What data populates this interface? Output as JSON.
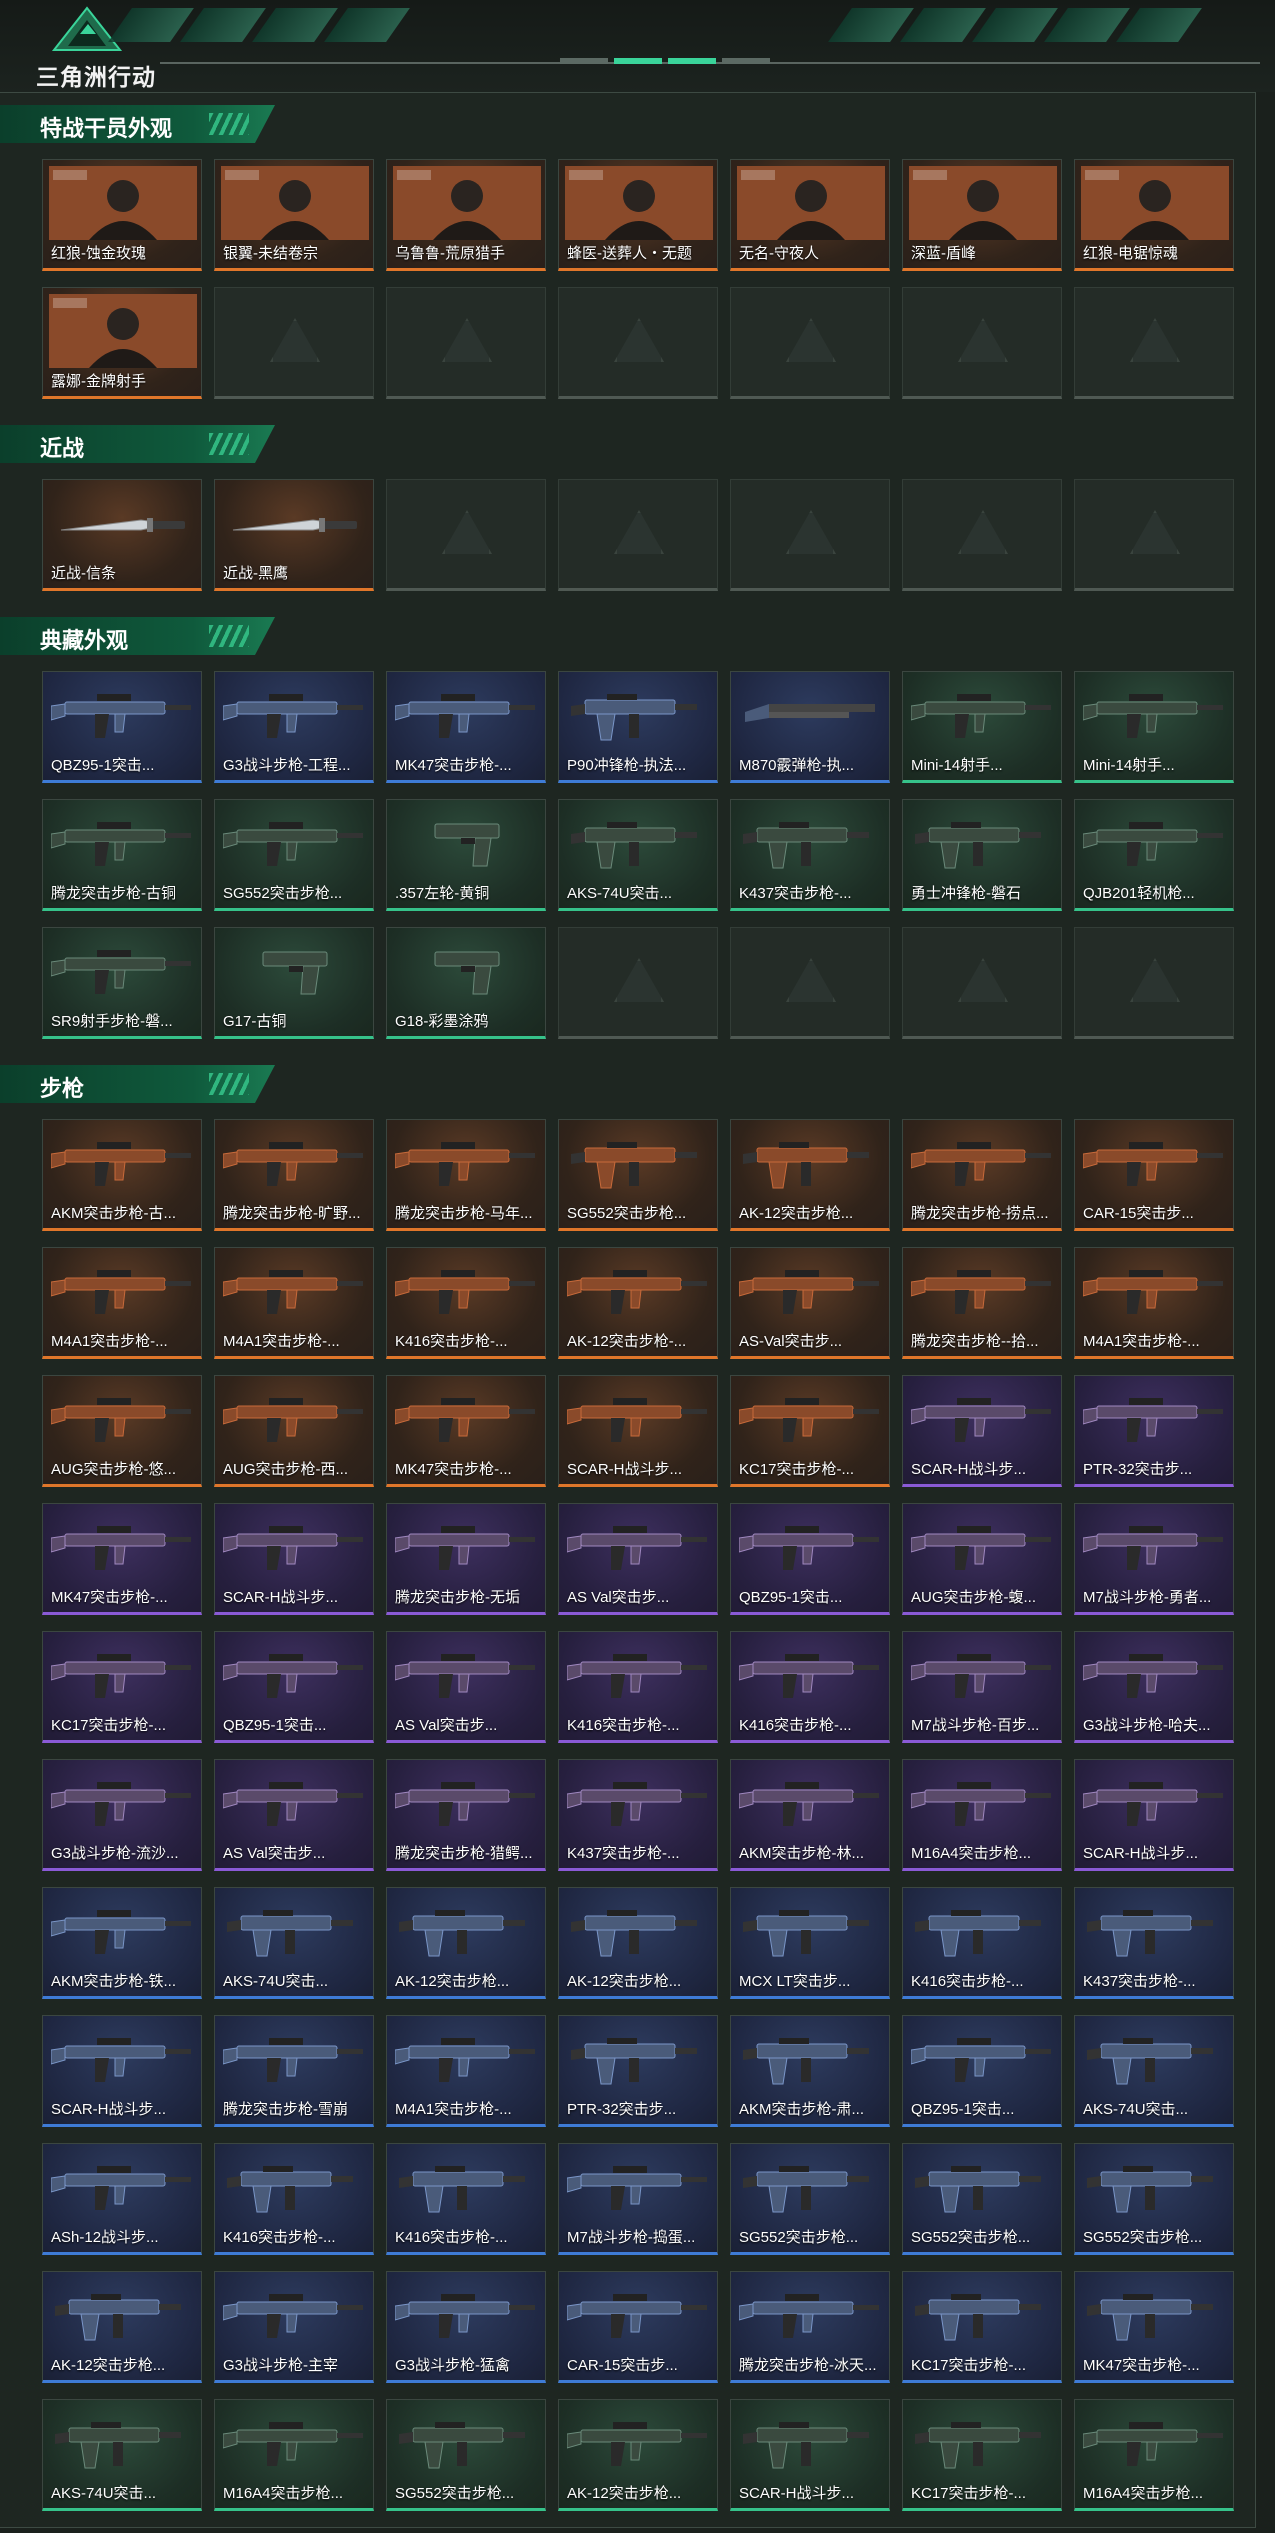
{
  "app": {
    "logo_text": "三角洲行动"
  },
  "sections": [
    {
      "title": "特战干员外观",
      "rows": 2,
      "items": [
        {
          "label": "红狼-蚀金玫瑰",
          "rarity": "orange",
          "kind": "operator"
        },
        {
          "label": "银翼-未结卷宗",
          "rarity": "orange",
          "kind": "operator"
        },
        {
          "label": "乌鲁鲁-荒原猎手",
          "rarity": "orange",
          "kind": "operator"
        },
        {
          "label": "蜂医-送葬人・无题",
          "rarity": "orange",
          "kind": "operator"
        },
        {
          "label": "无名-守夜人",
          "rarity": "orange",
          "kind": "operator"
        },
        {
          "label": "深蓝-盾峰",
          "rarity": "orange",
          "kind": "operator"
        },
        {
          "label": "红狼-电锯惊魂",
          "rarity": "orange",
          "kind": "operator"
        },
        {
          "label": "露娜-金牌射手",
          "rarity": "orange",
          "kind": "operator"
        }
      ]
    },
    {
      "title": "近战",
      "rows": 1,
      "items": [
        {
          "label": "近战-信条",
          "rarity": "orange",
          "kind": "knife"
        },
        {
          "label": "近战-黑鹰",
          "rarity": "orange",
          "kind": "knife"
        }
      ]
    },
    {
      "title": "典藏外观",
      "rows": 3,
      "items": [
        {
          "label": "QBZ95-1突击...",
          "rarity": "blue",
          "kind": "rifle"
        },
        {
          "label": "G3战斗步枪-工程...",
          "rarity": "blue",
          "kind": "rifle"
        },
        {
          "label": "MK47突击步枪-...",
          "rarity": "blue",
          "kind": "rifle"
        },
        {
          "label": "P90冲锋枪-执法...",
          "rarity": "blue",
          "kind": "smg"
        },
        {
          "label": "M870霰弹枪-执...",
          "rarity": "blue",
          "kind": "shotgun"
        },
        {
          "label": "Mini-14射手...",
          "rarity": "green",
          "kind": "rifle"
        },
        {
          "label": "Mini-14射手...",
          "rarity": "green",
          "kind": "rifle"
        },
        {
          "label": "腾龙突击步枪-古铜",
          "rarity": "green",
          "kind": "rifle"
        },
        {
          "label": "SG552突击步枪...",
          "rarity": "green",
          "kind": "rifle"
        },
        {
          "label": ".357左轮-黄铜",
          "rarity": "green",
          "kind": "pistol"
        },
        {
          "label": "AKS-74U突击...",
          "rarity": "green",
          "kind": "smg"
        },
        {
          "label": "K437突击步枪-...",
          "rarity": "green",
          "kind": "smg"
        },
        {
          "label": "勇士冲锋枪-磐石",
          "rarity": "green",
          "kind": "smg"
        },
        {
          "label": "QJB201轻机枪...",
          "rarity": "green",
          "kind": "rifle"
        },
        {
          "label": "SR9射手步枪-磐...",
          "rarity": "green",
          "kind": "rifle"
        },
        {
          "label": "G17-古铜",
          "rarity": "green",
          "kind": "pistol"
        },
        {
          "label": "G18-彩墨涂鸦",
          "rarity": "green",
          "kind": "pistol"
        }
      ]
    },
    {
      "title": "步枪",
      "rows": 11,
      "items": [
        {
          "label": "AKM突击步枪-古...",
          "rarity": "orange",
          "kind": "rifle"
        },
        {
          "label": "腾龙突击步枪-旷野...",
          "rarity": "orange",
          "kind": "rifle"
        },
        {
          "label": "腾龙突击步枪-马年...",
          "rarity": "orange",
          "kind": "rifle"
        },
        {
          "label": "SG552突击步枪...",
          "rarity": "orange",
          "kind": "smg"
        },
        {
          "label": "AK-12突击步枪...",
          "rarity": "orange",
          "kind": "smg"
        },
        {
          "label": "腾龙突击步枪-捞点...",
          "rarity": "orange",
          "kind": "rifle"
        },
        {
          "label": "CAR-15突击步...",
          "rarity": "orange",
          "kind": "rifle"
        },
        {
          "label": "M4A1突击步枪-...",
          "rarity": "orange",
          "kind": "rifle"
        },
        {
          "label": "M4A1突击步枪-...",
          "rarity": "orange",
          "kind": "rifle"
        },
        {
          "label": "K416突击步枪-...",
          "rarity": "orange",
          "kind": "rifle"
        },
        {
          "label": "AK-12突击步枪-...",
          "rarity": "orange",
          "kind": "rifle"
        },
        {
          "label": "AS-Val突击步...",
          "rarity": "orange",
          "kind": "rifle"
        },
        {
          "label": "腾龙突击步枪--拾...",
          "rarity": "orange",
          "kind": "rifle"
        },
        {
          "label": "M4A1突击步枪-...",
          "rarity": "orange",
          "kind": "rifle"
        },
        {
          "label": "AUG突击步枪-悠...",
          "rarity": "orange",
          "kind": "rifle"
        },
        {
          "label": "AUG突击步枪-西...",
          "rarity": "orange",
          "kind": "rifle"
        },
        {
          "label": "MK47突击步枪-...",
          "rarity": "orange",
          "kind": "rifle"
        },
        {
          "label": "SCAR-H战斗步...",
          "rarity": "orange",
          "kind": "rifle"
        },
        {
          "label": "KC17突击步枪-...",
          "rarity": "orange",
          "kind": "rifle"
        },
        {
          "label": "SCAR-H战斗步...",
          "rarity": "purple",
          "kind": "rifle"
        },
        {
          "label": "PTR-32突击步...",
          "rarity": "purple",
          "kind": "rifle"
        },
        {
          "label": "MK47突击步枪-...",
          "rarity": "purple",
          "kind": "rifle"
        },
        {
          "label": "SCAR-H战斗步...",
          "rarity": "purple",
          "kind": "rifle"
        },
        {
          "label": "腾龙突击步枪-无垢",
          "rarity": "purple",
          "kind": "rifle"
        },
        {
          "label": "AS Val突击步...",
          "rarity": "purple",
          "kind": "rifle"
        },
        {
          "label": "QBZ95-1突击...",
          "rarity": "purple",
          "kind": "rifle"
        },
        {
          "label": "AUG突击步枪-蝮...",
          "rarity": "purple",
          "kind": "rifle"
        },
        {
          "label": "M7战斗步枪-勇者...",
          "rarity": "purple",
          "kind": "rifle"
        },
        {
          "label": "KC17突击步枪-...",
          "rarity": "purple",
          "kind": "rifle"
        },
        {
          "label": "QBZ95-1突击...",
          "rarity": "purple",
          "kind": "rifle"
        },
        {
          "label": "AS Val突击步...",
          "rarity": "purple",
          "kind": "rifle"
        },
        {
          "label": "K416突击步枪-...",
          "rarity": "purple",
          "kind": "rifle"
        },
        {
          "label": "K416突击步枪-...",
          "rarity": "purple",
          "kind": "rifle"
        },
        {
          "label": "M7战斗步枪-百步...",
          "rarity": "purple",
          "kind": "rifle"
        },
        {
          "label": "G3战斗步枪-哈夫...",
          "rarity": "purple",
          "kind": "rifle"
        },
        {
          "label": "G3战斗步枪-流沙...",
          "rarity": "purple",
          "kind": "rifle"
        },
        {
          "label": "AS Val突击步...",
          "rarity": "purple",
          "kind": "rifle"
        },
        {
          "label": "腾龙突击步枪-猎鳄...",
          "rarity": "purple",
          "kind": "rifle"
        },
        {
          "label": "K437突击步枪-...",
          "rarity": "purple",
          "kind": "rifle"
        },
        {
          "label": "AKM突击步枪-林...",
          "rarity": "purple",
          "kind": "rifle"
        },
        {
          "label": "M16A4突击步枪...",
          "rarity": "purple",
          "kind": "rifle"
        },
        {
          "label": "SCAR-H战斗步...",
          "rarity": "purple",
          "kind": "rifle"
        },
        {
          "label": "AKM突击步枪-铁...",
          "rarity": "blue",
          "kind": "rifle"
        },
        {
          "label": "AKS-74U突击...",
          "rarity": "blue",
          "kind": "smg"
        },
        {
          "label": "AK-12突击步枪...",
          "rarity": "blue",
          "kind": "smg"
        },
        {
          "label": "AK-12突击步枪...",
          "rarity": "blue",
          "kind": "smg"
        },
        {
          "label": "MCX LT突击步...",
          "rarity": "blue",
          "kind": "smg"
        },
        {
          "label": "K416突击步枪-...",
          "rarity": "blue",
          "kind": "smg"
        },
        {
          "label": "K437突击步枪-...",
          "rarity": "blue",
          "kind": "smg"
        },
        {
          "label": "SCAR-H战斗步...",
          "rarity": "blue",
          "kind": "rifle"
        },
        {
          "label": "腾龙突击步枪-雪崩",
          "rarity": "blue",
          "kind": "rifle"
        },
        {
          "label": "M4A1突击步枪-...",
          "rarity": "blue",
          "kind": "rifle"
        },
        {
          "label": "PTR-32突击步...",
          "rarity": "blue",
          "kind": "smg"
        },
        {
          "label": "AKM突击步枪-肃...",
          "rarity": "blue",
          "kind": "smg"
        },
        {
          "label": "QBZ95-1突击...",
          "rarity": "blue",
          "kind": "rifle"
        },
        {
          "label": "AKS-74U突击...",
          "rarity": "blue",
          "kind": "smg"
        },
        {
          "label": "ASh-12战斗步...",
          "rarity": "blue",
          "kind": "rifle"
        },
        {
          "label": "K416突击步枪-...",
          "rarity": "blue",
          "kind": "smg"
        },
        {
          "label": "K416突击步枪-...",
          "rarity": "blue",
          "kind": "smg"
        },
        {
          "label": "M7战斗步枪-捣蛋...",
          "rarity": "blue",
          "kind": "rifle"
        },
        {
          "label": "SG552突击步枪...",
          "rarity": "blue",
          "kind": "smg"
        },
        {
          "label": "SG552突击步枪...",
          "rarity": "blue",
          "kind": "smg"
        },
        {
          "label": "SG552突击步枪...",
          "rarity": "blue",
          "kind": "smg"
        },
        {
          "label": "AK-12突击步枪...",
          "rarity": "blue",
          "kind": "smg"
        },
        {
          "label": "G3战斗步枪-主宰",
          "rarity": "blue",
          "kind": "rifle"
        },
        {
          "label": "G3战斗步枪-猛禽",
          "rarity": "blue",
          "kind": "rifle"
        },
        {
          "label": "CAR-15突击步...",
          "rarity": "blue",
          "kind": "rifle"
        },
        {
          "label": "腾龙突击步枪-冰天...",
          "rarity": "blue",
          "kind": "rifle"
        },
        {
          "label": "KC17突击步枪-...",
          "rarity": "blue",
          "kind": "smg"
        },
        {
          "label": "MK47突击步枪-...",
          "rarity": "blue",
          "kind": "smg"
        },
        {
          "label": "AKS-74U突击...",
          "rarity": "green",
          "kind": "smg"
        },
        {
          "label": "M16A4突击步枪...",
          "rarity": "green",
          "kind": "rifle"
        },
        {
          "label": "SG552突击步枪...",
          "rarity": "green",
          "kind": "smg"
        },
        {
          "label": "AK-12突击步枪...",
          "rarity": "green",
          "kind": "rifle"
        },
        {
          "label": "SCAR-H战斗步...",
          "rarity": "green",
          "kind": "smg"
        },
        {
          "label": "KC17突击步枪-...",
          "rarity": "green",
          "kind": "smg"
        },
        {
          "label": "M16A4突击步枪...",
          "rarity": "green",
          "kind": "rifle"
        }
      ]
    }
  ],
  "colors": {
    "orange": "#e0762a",
    "blue": "#3e7bd6",
    "green": "#36c28a",
    "purple": "#8a5ad6",
    "accent": "#35c58a"
  }
}
